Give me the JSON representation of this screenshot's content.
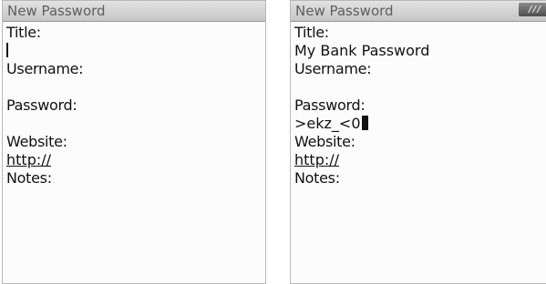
{
  "left_screen": {
    "title": "New Password",
    "fields": {
      "title_label": "Title:",
      "title_value": "",
      "username_label": "Username:",
      "username_value": "",
      "password_label": "Password:",
      "password_value": "",
      "website_label": "Website:",
      "website_value": "http://",
      "notes_label": "Notes:"
    }
  },
  "right_screen": {
    "title": "New Password",
    "signal_badge": "///",
    "fields": {
      "title_label": "Title:",
      "title_value": "My Bank Password",
      "username_label": "Username:",
      "username_value": "",
      "password_label": "Password:",
      "password_value": ">ekz_<0",
      "website_label": "Website:",
      "website_value": "http://",
      "notes_label": "Notes:"
    }
  }
}
